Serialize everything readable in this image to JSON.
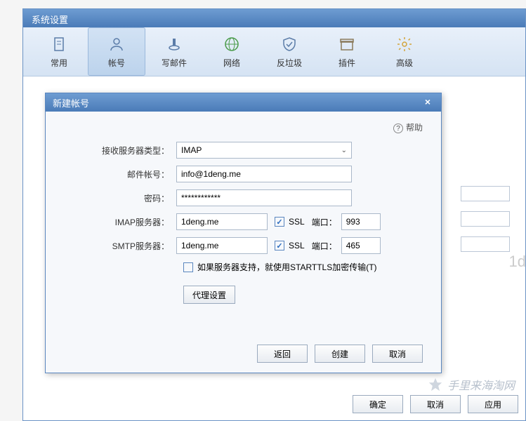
{
  "main": {
    "title": "系统设置",
    "toolbar": [
      {
        "label": "常用",
        "icon": "page"
      },
      {
        "label": "帐号",
        "icon": "user"
      },
      {
        "label": "写邮件",
        "icon": "ink"
      },
      {
        "label": "网络",
        "icon": "globe"
      },
      {
        "label": "反垃圾",
        "icon": "shield"
      },
      {
        "label": "插件",
        "icon": "box"
      },
      {
        "label": "高级",
        "icon": "gear"
      }
    ],
    "active_tab_index": 1,
    "footer": {
      "ok": "确定",
      "cancel": "取消",
      "apply": "应用"
    }
  },
  "dialog": {
    "title": "新建帐号",
    "help_label": "帮助",
    "labels": {
      "server_type": "接收服务器类型：",
      "email": "邮件帐号：",
      "password": "密码：",
      "imap_server": "IMAP服务器：",
      "smtp_server": "SMTP服务器：",
      "ssl": "SSL",
      "port": "端口：",
      "starttls": "如果服务器支持，就使用STARTTLS加密传输(T)",
      "proxy": "代理设置"
    },
    "values": {
      "server_type": "IMAP",
      "email": "info@1deng.me",
      "password": "************",
      "imap_server": "1deng.me",
      "smtp_server": "1deng.me",
      "imap_ssl_checked": true,
      "smtp_ssl_checked": true,
      "starttls_checked": false,
      "imap_port": "993",
      "smtp_port": "465"
    },
    "footer": {
      "back": "返回",
      "create": "创建",
      "cancel": "取消"
    }
  },
  "watermark": "手里来海淘网",
  "side_text": "1d"
}
